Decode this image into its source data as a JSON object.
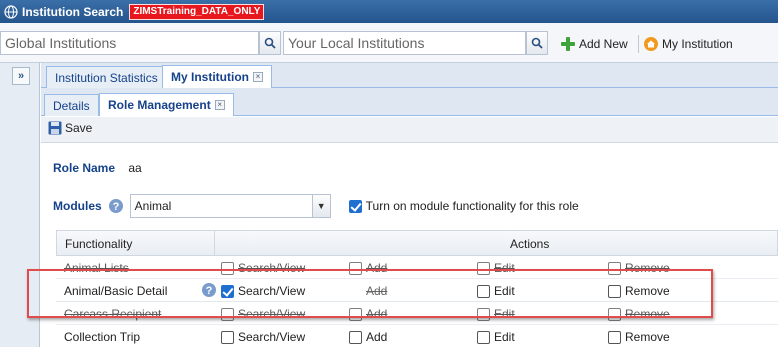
{
  "window": {
    "title": "Institution Search",
    "env_badge": "ZIMSTraining_DATA_ONLY"
  },
  "search": {
    "global_label": "Global Institutions",
    "local_label": "Your Local Institutions",
    "add_new": "Add New",
    "my_institution": "My Institution"
  },
  "tabs_level1": [
    {
      "label": "Institution Statistics",
      "active": false
    },
    {
      "label": "My Institution",
      "active": true
    }
  ],
  "tabs_level2": [
    {
      "label": "Details",
      "active": false
    },
    {
      "label": "Role Management",
      "active": true
    }
  ],
  "toolbar": {
    "save_label": "Save"
  },
  "form": {
    "role_name_label": "Role Name",
    "role_name_value": "aa",
    "modules_label": "Modules",
    "modules_value": "Animal",
    "turn_on_label": "Turn on module functionality for this role",
    "turn_on_checked": true
  },
  "grid": {
    "headers": {
      "functionality": "Functionality",
      "actions": "Actions"
    },
    "rows": [
      {
        "name": "Animal Lists",
        "search": "Search/View",
        "add": "Add",
        "edit": "Edit",
        "remove": "Remove",
        "search_checked": false,
        "disabled": true
      },
      {
        "name": "Animal/Basic Detail",
        "search": "Search/View",
        "add": "Add",
        "edit": "Edit",
        "remove": "Remove",
        "search_checked": true,
        "disabled": false
      },
      {
        "name": "Carcass Recipient",
        "search": "Search/View",
        "add": "Add",
        "edit": "Edit",
        "remove": "Remove",
        "search_checked": false,
        "disabled": true
      },
      {
        "name": "Collection Trip",
        "search": "Search/View",
        "add": "Add",
        "edit": "Edit",
        "remove": "Remove",
        "search_checked": false,
        "disabled": false
      }
    ]
  },
  "colors": {
    "title_bg": "#24548c",
    "badge": "#e8171d",
    "highlight": "#e04c4c",
    "check": "#1f6fd1"
  }
}
